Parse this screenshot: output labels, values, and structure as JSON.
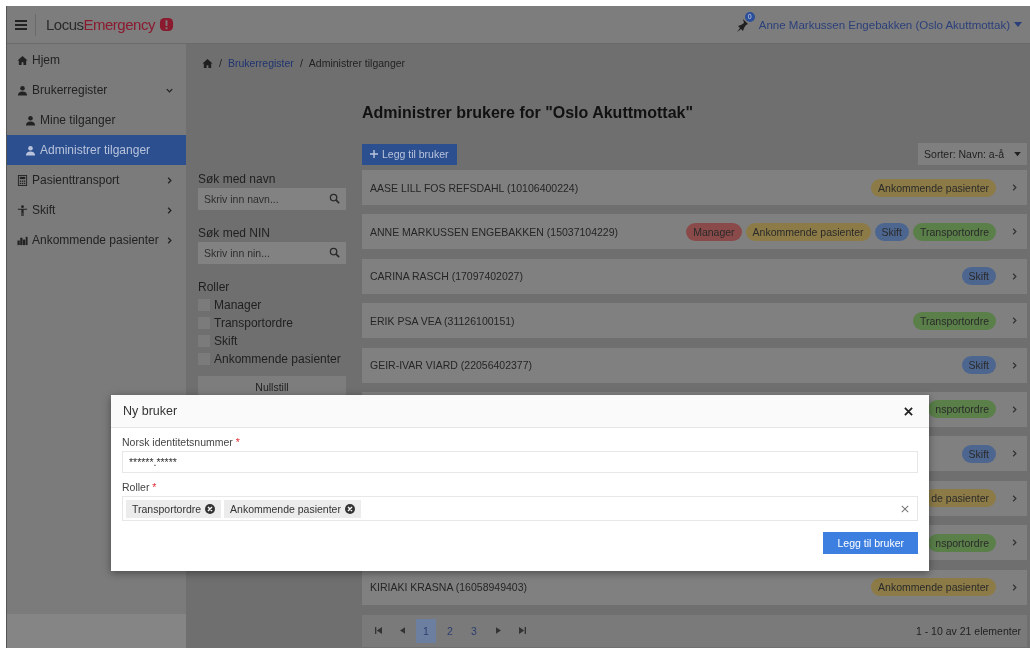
{
  "header": {
    "logo_prefix": "Locus",
    "logo_suffix": "Emergency",
    "notification_count": "0",
    "user": "Anne Markussen Engebakken (Oslo Akuttmottak)"
  },
  "sidebar": {
    "items": [
      {
        "label": "Hjem",
        "kind": "home",
        "selected": false
      },
      {
        "label": "Brukerregister",
        "kind": "user",
        "selected": false,
        "expanded": true,
        "children": [
          {
            "label": "Mine tilganger",
            "kind": "user",
            "selected": false
          },
          {
            "label": "Administrer tilganger",
            "kind": "user",
            "selected": true
          }
        ]
      },
      {
        "label": "Pasienttransport",
        "kind": "calc",
        "selected": false,
        "expanded": false
      },
      {
        "label": "Skift",
        "kind": "person",
        "selected": false,
        "expanded": false
      },
      {
        "label": "Ankommende pasienter",
        "kind": "chart",
        "selected": false,
        "expanded": false
      }
    ]
  },
  "breadcrumb_separator": "/",
  "breadcrumb": [
    {
      "label": "Brukerregister",
      "kind": "link"
    },
    {
      "label": "Administrer tilganger",
      "kind": "current"
    }
  ],
  "title": "Administrer brukere for \"Oslo Akuttmottak\"",
  "add_button": "Legg til bruker",
  "sort": "Sorter: Navn: a-å",
  "filters": {
    "name_label": "Søk med navn",
    "name_placeholder": "Skriv inn navn...",
    "nin_label": "Søk med NIN",
    "nin_placeholder": "Skriv inn nin...",
    "roles_label": "Roller",
    "roles": [
      {
        "label": "Manager",
        "checked": false
      },
      {
        "label": "Transportordre",
        "checked": false
      },
      {
        "label": "Skift",
        "checked": false
      },
      {
        "label": "Ankommende pasienter",
        "checked": false
      }
    ],
    "reset": "Nullstill"
  },
  "users": [
    {
      "name": "AASE LILL FOS REFSDAHL (10106400224)",
      "roles": [
        {
          "label": "Ankommende pasienter",
          "color": "#8c7b46"
        }
      ]
    },
    {
      "name": "ANNE MARKUSSEN ENGEBAKKEN (15037104229)",
      "roles": [
        {
          "label": "Manager",
          "color": "#8a4a4a"
        },
        {
          "label": "Ankommende pasienter",
          "color": "#8c7b46"
        },
        {
          "label": "Skift",
          "color": "#4d6690"
        },
        {
          "label": "Transportordre",
          "color": "#5a7f49"
        }
      ]
    },
    {
      "name": "CARINA RASCH (17097402027)",
      "roles": [
        {
          "label": "Skift",
          "color": "#4d6690"
        }
      ]
    },
    {
      "name": "ERIK PSA VEA (31126100151)",
      "roles": [
        {
          "label": "Transportordre",
          "color": "#5a7f49"
        }
      ]
    },
    {
      "name": "GEIR-IVAR VIARD (22056402377)",
      "roles": [
        {
          "label": "Skift",
          "color": "#4d6690"
        }
      ]
    },
    {
      "roles": [
        {
          "label": "nsportordre",
          "color": "#5a7f49"
        }
      ]
    },
    {
      "roles": [
        {
          "label": "Skift",
          "color": "#4d6690"
        }
      ]
    },
    {
      "roles": [
        {
          "label": "de pasienter",
          "color": "#8c7b46"
        }
      ]
    },
    {
      "roles": [
        {
          "label": "nsportordre",
          "color": "#5a7f49"
        }
      ]
    },
    {
      "name": "KIRIAKI KRASNA (16058949403)",
      "roles": [
        {
          "label": "Ankommende pasienter",
          "color": "#8c7b46"
        }
      ]
    }
  ],
  "pagination": {
    "pages": [
      {
        "label": "1",
        "selected": true
      },
      {
        "label": "2",
        "selected": false
      },
      {
        "label": "3",
        "selected": false
      }
    ],
    "summary": "1 - 10 av 21 elementer"
  },
  "modal": {
    "title": "Ny bruker",
    "nin_label": "Norsk identitetsnummer",
    "nin_value": "******.*****",
    "roles_label": "Roller",
    "required_mark": "*",
    "chips": [
      "Transportordre",
      "Ankommende pasienter"
    ],
    "submit": "Legg til bruker"
  }
}
